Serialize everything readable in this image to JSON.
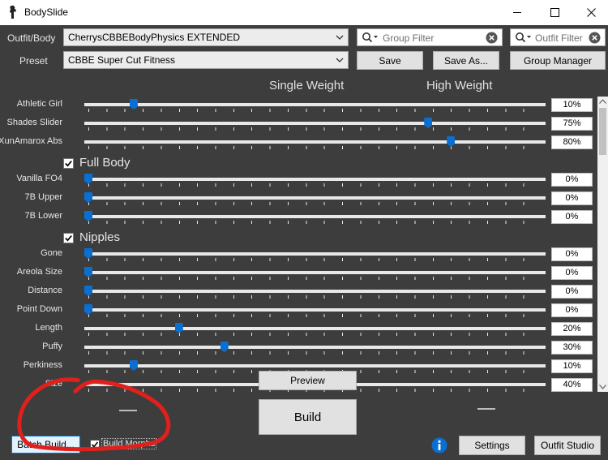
{
  "window": {
    "title": "BodySlide"
  },
  "toolbar": {
    "outfit_label": "Outfit/Body",
    "outfit_value": "CherrysCBBEBodyPhysics EXTENDED",
    "preset_label": "Preset",
    "preset_value": "CBBE Super Cut Fitness",
    "group_filter_placeholder": "Group Filter",
    "outfit_filter_placeholder": "Outfit Filter",
    "save_label": "Save",
    "save_as_label": "Save As...",
    "group_manager_label": "Group Manager"
  },
  "columns": {
    "single": "Single Weight",
    "high": "High Weight"
  },
  "sliders": [
    {
      "name": "Athletic Girl",
      "value": 10,
      "display": "10%",
      "tooltip": ""
    },
    {
      "name": "Shades Slider",
      "value": 75,
      "display": "75%"
    },
    {
      "name": "XunAmarox Abs",
      "value": 80,
      "display": "80%"
    }
  ],
  "groups": [
    {
      "name": "Full Body",
      "checked": true,
      "sliders": [
        {
          "name": "Vanilla FO4",
          "value": 0,
          "display": "0%"
        },
        {
          "name": "7B Upper",
          "value": 0,
          "display": "0%"
        },
        {
          "name": "7B Lower",
          "value": 0,
          "display": "0%"
        }
      ]
    },
    {
      "name": "Nipples",
      "checked": true,
      "sliders": [
        {
          "name": "Gone",
          "value": 0,
          "display": "0%"
        },
        {
          "name": "Areola Size",
          "value": 0,
          "display": "0%"
        },
        {
          "name": "Distance",
          "value": 0,
          "display": "0%"
        },
        {
          "name": "Point Down",
          "value": 0,
          "display": "0%"
        },
        {
          "name": "Length",
          "value": 20,
          "display": "20%"
        },
        {
          "name": "Puffy",
          "value": 30,
          "display": "30%"
        },
        {
          "name": "Perkiness",
          "value": 10,
          "display": "10%"
        },
        {
          "name": "Size",
          "value": 40,
          "display": "40%"
        }
      ]
    }
  ],
  "footer": {
    "batch_build_label": "Batch Build...",
    "build_morphs_label": "Build Morphs",
    "build_morphs_checked": true,
    "preview_label": "Preview",
    "build_label": "Build",
    "settings_label": "Settings",
    "outfit_studio_label": "Outfit Studio"
  },
  "colors": {
    "accent": "#0a6fd1",
    "background": "#3d3d3d",
    "annotation": "#e0201c"
  },
  "icons": {
    "app": "figure-icon",
    "info": "info-icon",
    "search": "search-icon",
    "clear": "clear-icon"
  }
}
